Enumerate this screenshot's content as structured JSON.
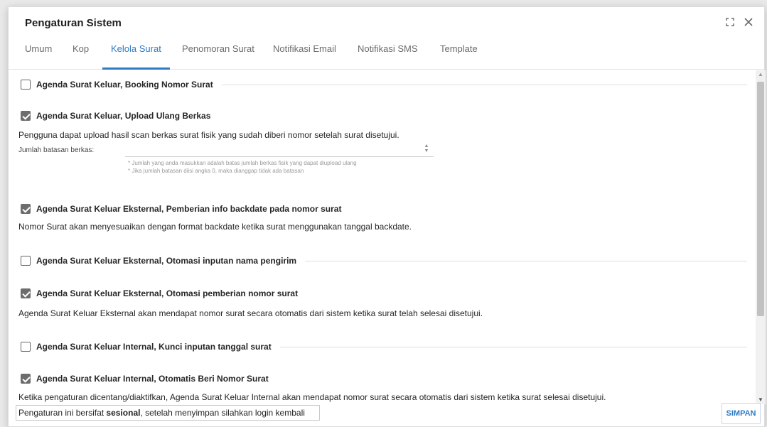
{
  "dialog": {
    "title": "Pengaturan Sistem",
    "maximize_icon": "maximize-icon",
    "close_icon": "close-icon"
  },
  "tabs": [
    {
      "label": "Umum",
      "active": false
    },
    {
      "label": "Kop",
      "active": false
    },
    {
      "label": "Kelola Surat",
      "active": true
    },
    {
      "label": "Penomoran Surat",
      "active": false
    },
    {
      "label": "Notifikasi Email",
      "active": false
    },
    {
      "label": "Notifikasi SMS",
      "active": false
    },
    {
      "label": "Template",
      "active": false
    }
  ],
  "sections": [
    {
      "label": "Agenda Surat Keluar, Booking Nomor Surat",
      "checked": false
    },
    {
      "label": "Agenda Surat Keluar, Upload Ulang Berkas",
      "checked": true,
      "description": "Pengguna dapat upload hasil scan berkas surat fisik yang sudah diberi nomor setelah surat disetujui."
    },
    {
      "label": "Agenda Surat Keluar Eksternal, Pemberian info backdate pada nomor surat",
      "checked": true,
      "description": "Nomor Surat akan menyesuaikan dengan format backdate ketika surat menggunakan tanggal backdate."
    },
    {
      "label": "Agenda Surat Keluar Eksternal, Otomasi inputan nama pengirim",
      "checked": false
    },
    {
      "label": "Agenda Surat Keluar Eksternal, Otomasi pemberian nomor surat",
      "checked": true,
      "description": "Agenda Surat Keluar Eksternal akan mendapat nomor surat secara otomatis dari sistem ketika surat telah selesai disetujui."
    },
    {
      "label": "Agenda Surat Keluar Internal, Kunci inputan tanggal surat",
      "checked": false
    },
    {
      "label": "Agenda Surat Keluar Internal, Otomatis Beri Nomor Surat",
      "checked": true,
      "description": "Ketika pengaturan dicentang/diaktifkan, Agenda Surat Keluar Internal akan mendapat nomor surat secara otomatis dari sistem ketika surat selesai disetujui."
    }
  ],
  "upload_limit": {
    "label": "Jumlah batasan berkas:",
    "value": "",
    "hint1": "* Jumlah yang anda masukkan adalah batas jumlah berkas fisik yang dapat diupload ulang",
    "hint2": "* Jika jumlah batasan diisi angka 0, maka dianggap tidak ada batasan"
  },
  "footer": {
    "note_prefix": "Pengaturan ini bersifat ",
    "note_bold": "sesional",
    "note_suffix": ", setelah menyimpan silahkan login kembali",
    "save_label": "SIMPAN"
  }
}
